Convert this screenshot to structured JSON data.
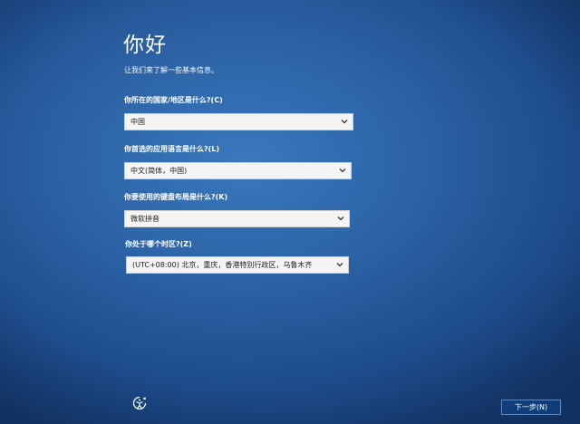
{
  "heading": {
    "title": "你好",
    "subtitle": "让我们来了解一些基本信息。"
  },
  "fields": [
    {
      "label": "你所在的国家/地区是什么?(C)",
      "value": "中国"
    },
    {
      "label": "你首选的应用语言是什么?(L)",
      "value": "中文(简体，中国)"
    },
    {
      "label": "你要使用的键盘布局是什么?(K)",
      "value": "微软拼音"
    },
    {
      "label": "你处于哪个时区?(Z)",
      "value": "(UTC+08:00) 北京，重庆，香港特别行政区，乌鲁木齐"
    }
  ],
  "icons": {
    "accessibility": "accessibility-icon",
    "dropdown": "chevron-down-icon"
  },
  "footer": {
    "next_label": "下一步(N)"
  },
  "colors": {
    "background": "#2c63a6",
    "button": "#0f3c7a",
    "field": "#f4f4f4"
  }
}
